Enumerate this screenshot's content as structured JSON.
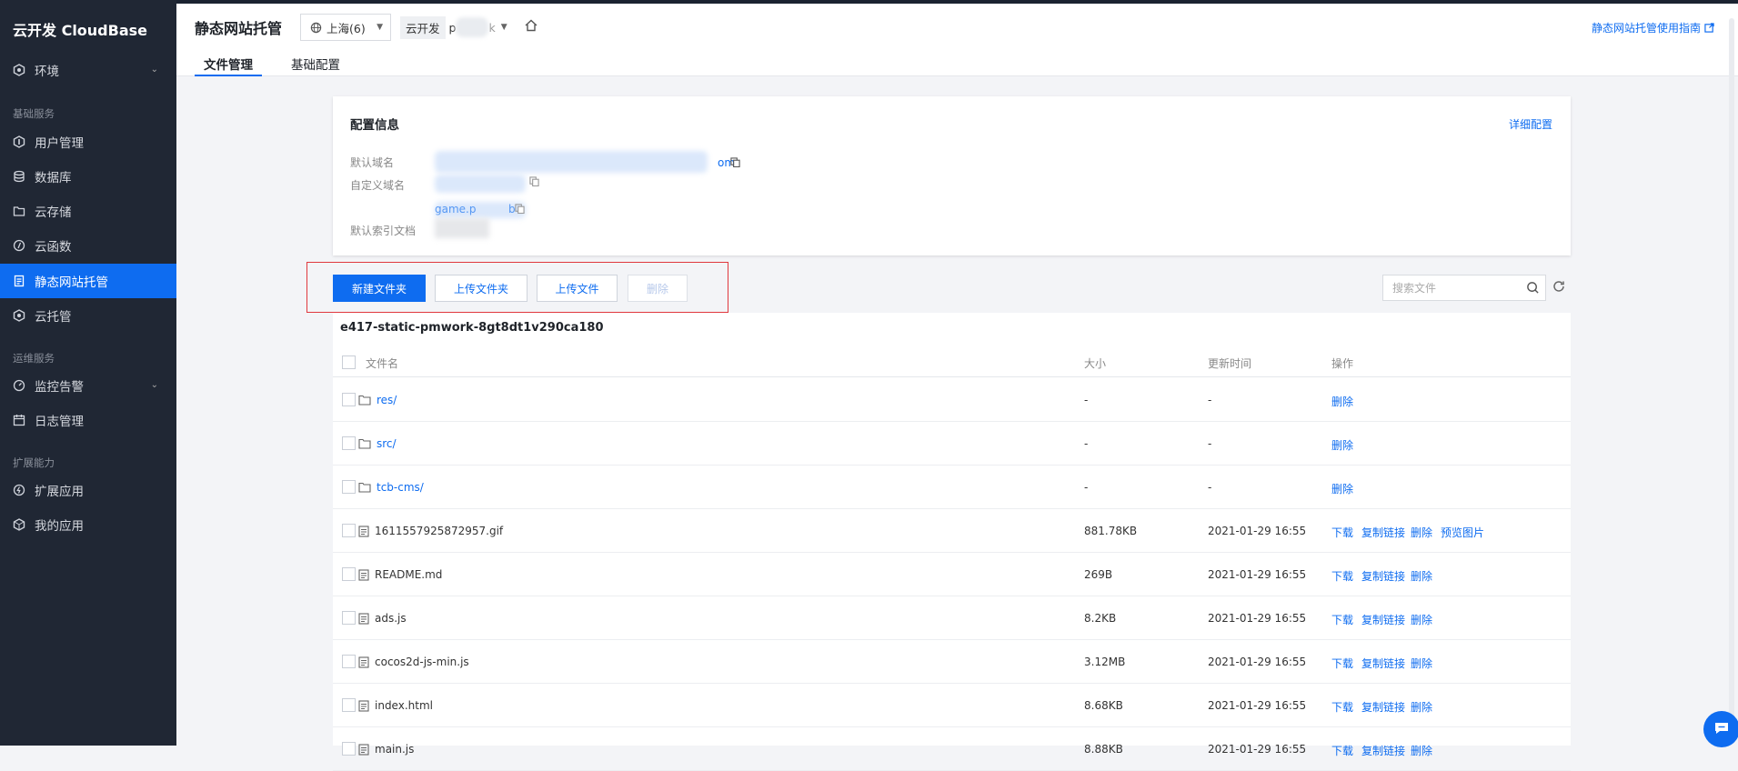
{
  "sidebar": {
    "brand": "云开发 CloudBase",
    "env_label": "环境",
    "group_basic": "基础服务",
    "group_ops": "运维服务",
    "group_ext": "扩展能力",
    "items": {
      "user": "用户管理",
      "db": "数据库",
      "storage": "云存储",
      "func": "云函数",
      "hosting": "静态网站托管",
      "cloudrun": "云托管",
      "monitor": "监控告警",
      "log": "日志管理",
      "ext_app": "扩展应用",
      "my_app": "我的应用"
    }
  },
  "header": {
    "title": "静态网站托管",
    "region": "上海(6)",
    "env_tag": "云开发",
    "env_text_a": "p",
    "env_text_b": "k",
    "guide": "静态网站托管使用指南",
    "tabs": {
      "files": "文件管理",
      "basic": "基础配置"
    }
  },
  "config": {
    "title": "配置信息",
    "detail_link": "详细配置",
    "default_domain": "默认域名",
    "domain_tail": "om",
    "custom_domain": "自定义域名",
    "domain_frag": "game.p",
    "domain_frag2": "b",
    "index_doc": "默认索引文档"
  },
  "toolbar": {
    "new_folder": "新建文件夹",
    "upload_folder": "上传文件夹",
    "upload_file": "上传文件",
    "delete": "删除",
    "search_placeholder": "搜索文件"
  },
  "table": {
    "bucket": "e417-static-pmwork-8gt8dt1v290ca180",
    "headers": {
      "name": "文件名",
      "size": "大小",
      "time": "更新时间",
      "ops": "操作"
    },
    "actions": {
      "download": "下载",
      "copy": "复制链接",
      "delete": "删除",
      "preview": "预览图片"
    },
    "rows": [
      {
        "name": "res/",
        "size": "-",
        "time": "-"
      },
      {
        "name": "src/",
        "size": "-",
        "time": "-"
      },
      {
        "name": "tcb-cms/",
        "size": "-",
        "time": "-"
      },
      {
        "name": "1611557925872957.gif",
        "size": "881.78KB",
        "time": "2021-01-29 16:55"
      },
      {
        "name": "README.md",
        "size": "269B",
        "time": "2021-01-29 16:55"
      },
      {
        "name": "ads.js",
        "size": "8.2KB",
        "time": "2021-01-29 16:55"
      },
      {
        "name": "cocos2d-js-min.js",
        "size": "3.12MB",
        "time": "2021-01-29 16:55"
      },
      {
        "name": "index.html",
        "size": "8.68KB",
        "time": "2021-01-29 16:55"
      },
      {
        "name": "main.js",
        "size": "8.88KB",
        "time": "2021-01-29 16:55"
      }
    ]
  },
  "colors": {
    "accent": "#0e6cf0",
    "sidebar": "#202734",
    "highlight_frame": "#e0383e"
  }
}
